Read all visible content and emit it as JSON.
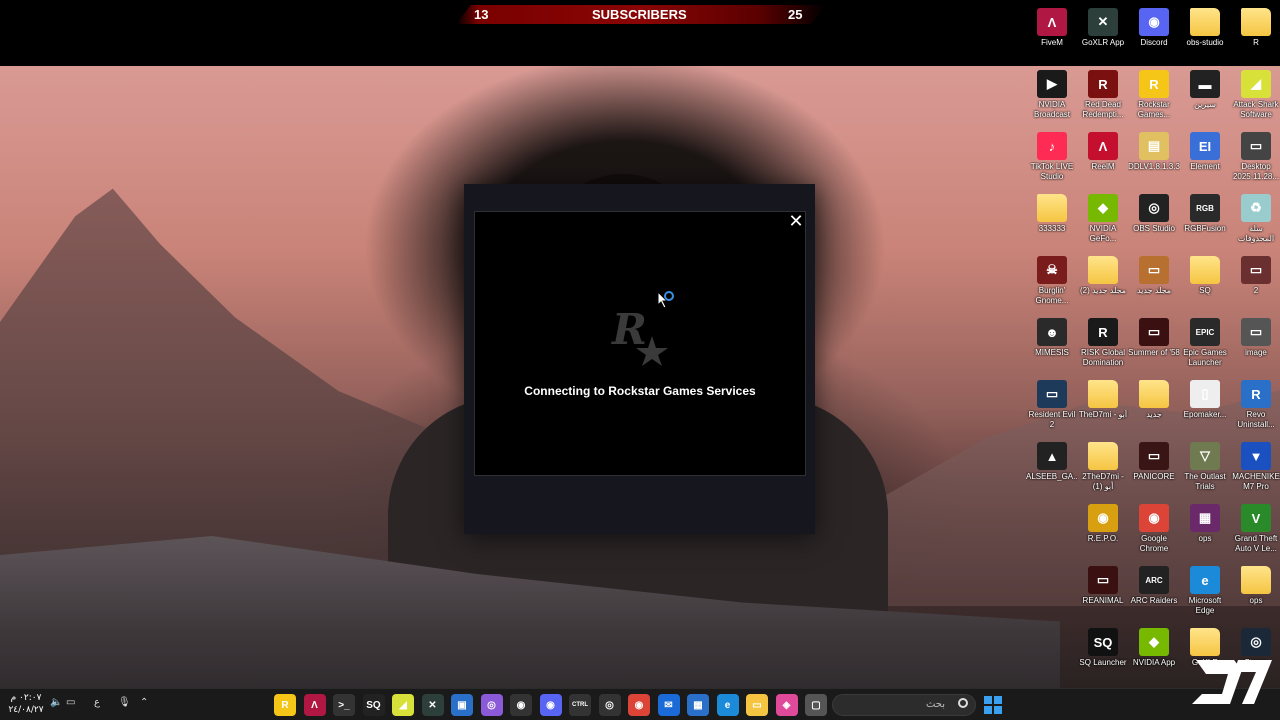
{
  "stream_bar": {
    "left_value": "13",
    "title": "SUBSCRIBERS",
    "right_value": "25"
  },
  "launcher": {
    "status_text": "Connecting to Rockstar Games Services",
    "close_label": "✕"
  },
  "desktop_icons": [
    {
      "label": "FiveM",
      "color": "#b01843",
      "glyph": "Λ"
    },
    {
      "label": "GoXLR App",
      "color": "#2c3f3a",
      "glyph": "✕"
    },
    {
      "label": "Discord",
      "color": "#5865f2",
      "glyph": "◉"
    },
    {
      "label": "obs-studio",
      "folder": true
    },
    {
      "label": "R",
      "folder": true
    },
    {
      "label": "NVIDIA Broadcast",
      "color": "#1a1a1a",
      "glyph": "▶"
    },
    {
      "label": "Red Dead Redempti...",
      "color": "#7a1010",
      "glyph": "R"
    },
    {
      "label": "Rockstar Games...",
      "color": "#f5c518",
      "glyph": "R"
    },
    {
      "label": "سيزين",
      "color": "#222",
      "glyph": "▬"
    },
    {
      "label": "Attack Shark Software",
      "color": "#d8e03a",
      "glyph": "◢"
    },
    {
      "label": "TikTok LIVE Studio",
      "color": "#fe2c55",
      "glyph": "♪"
    },
    {
      "label": "ReelM",
      "color": "#c4102e",
      "glyph": "Λ"
    },
    {
      "label": "DDLV1.8.1.3.3",
      "color": "#e0c060",
      "glyph": "▤"
    },
    {
      "label": "Element",
      "color": "#3a6fd8",
      "glyph": "EI"
    },
    {
      "label": "Desktop 2025.11.28...",
      "color": "#444",
      "glyph": "▭"
    },
    {
      "label": "333333",
      "folder": true
    },
    {
      "label": "NVIDIA GeFo...",
      "color": "#76b900",
      "glyph": "◆"
    },
    {
      "label": "OBS Studio",
      "color": "#222",
      "glyph": "◎"
    },
    {
      "label": "RGBFusion",
      "color": "#2a2a2a",
      "glyph": "RGB"
    },
    {
      "label": "سلة المحذوفات",
      "color": "#9cc",
      "glyph": "♻"
    },
    {
      "label": "Burglin' Gnome...",
      "color": "#7a1c1c",
      "glyph": "☠"
    },
    {
      "label": "مجلد جديد (2)",
      "folder": true
    },
    {
      "label": "مجلد جديد",
      "color": "#b87030",
      "glyph": "▭"
    },
    {
      "label": "SQ",
      "folder": true
    },
    {
      "label": "2",
      "color": "#6a3030",
      "glyph": "▭"
    },
    {
      "label": "MIMESIS",
      "color": "#2a2a2a",
      "glyph": "☻"
    },
    {
      "label": "RISK Global Domination",
      "color": "#1a1a1a",
      "glyph": "R"
    },
    {
      "label": "Summer of '58",
      "color": "#3a1010",
      "glyph": "▭"
    },
    {
      "label": "Epic Games Launcher",
      "color": "#2a2a2a",
      "glyph": "EPIC"
    },
    {
      "label": "image",
      "color": "#555",
      "glyph": "▭"
    },
    {
      "label": "Resident Evil 2",
      "color": "#1e3a5a",
      "glyph": "▭"
    },
    {
      "label": "TheD7mi - أبو",
      "folder": true
    },
    {
      "label": "جديد",
      "folder": true
    },
    {
      "label": "Epomaker...",
      "color": "#eeeeee",
      "glyph": "▯"
    },
    {
      "label": "Revo Uninstall...",
      "color": "#2a70c8",
      "glyph": "R"
    },
    {
      "label": "ALSEEB_GA...",
      "color": "#222",
      "glyph": "▲"
    },
    {
      "label": "2TheD7mi - أبو (1)",
      "folder": true
    },
    {
      "label": "PANICORE",
      "color": "#3a1515",
      "glyph": "▭"
    },
    {
      "label": "The Outlast Trials",
      "color": "#707a50",
      "glyph": "▽"
    },
    {
      "label": "MACHENIKE M7 Pro",
      "color": "#1a50c0",
      "glyph": "▼"
    },
    {
      "label": "R.E.P.O.",
      "color": "#d8a010",
      "glyph": "◉"
    },
    {
      "label": "Google Chrome",
      "color": "#db4437",
      "glyph": "◉"
    },
    {
      "label": "ops",
      "color": "#6a2a6a",
      "glyph": "▦"
    },
    {
      "label": "Grand Theft Auto V Le...",
      "color": "#2a8a2a",
      "glyph": "V"
    },
    {
      "label": "REANIMAL",
      "color": "#3a1010",
      "glyph": "▭"
    },
    {
      "label": "ARC Raiders",
      "color": "#222",
      "glyph": "ARC"
    },
    {
      "label": "Microsoft Edge",
      "color": "#1b8ad8",
      "glyph": "e"
    },
    {
      "label": "ops",
      "folder": true
    },
    {
      "label": "SQ Launcher",
      "color": "#111",
      "glyph": "SQ"
    },
    {
      "label": "NVIDIA App",
      "color": "#76b900",
      "glyph": "◆"
    },
    {
      "label": "GoXLR",
      "folder": true
    },
    {
      "label": "Steam",
      "color": "#1b2838",
      "glyph": "◎"
    }
  ],
  "taskbar": {
    "search_placeholder": "بحث",
    "clock_time": "٠٢:٠٧ م",
    "clock_date": "٢٤/٠٨/٢٧",
    "tray_lang": "ع",
    "apps": [
      {
        "name": "rockstar",
        "glyph": "R",
        "color": "#f5c518"
      },
      {
        "name": "fivem",
        "glyph": "Λ",
        "color": "#b01843"
      },
      {
        "name": "terminal",
        "glyph": ">_",
        "color": "#333"
      },
      {
        "name": "sq",
        "glyph": "SQ",
        "color": "#222"
      },
      {
        "name": "attack-shark",
        "glyph": "◢",
        "color": "#d8e03a"
      },
      {
        "name": "goxlr",
        "glyph": "✕",
        "color": "#2c3f3a"
      },
      {
        "name": "window-app",
        "glyph": "▣",
        "color": "#2a70c8"
      },
      {
        "name": "purple-app",
        "glyph": "◎",
        "color": "#8a5ad8"
      },
      {
        "name": "github",
        "glyph": "◉",
        "color": "#333"
      },
      {
        "name": "discord",
        "glyph": "◉",
        "color": "#5865f2"
      },
      {
        "name": "ctrl",
        "glyph": "CTRL",
        "color": "#333"
      },
      {
        "name": "obs",
        "glyph": "◎",
        "color": "#333"
      },
      {
        "name": "chrome",
        "glyph": "◉",
        "color": "#db4437"
      },
      {
        "name": "outlook",
        "glyph": "✉",
        "color": "#1a6ad8"
      },
      {
        "name": "store",
        "glyph": "▦",
        "color": "#2a70c8"
      },
      {
        "name": "edge",
        "glyph": "e",
        "color": "#1b8ad8"
      },
      {
        "name": "explorer",
        "glyph": "▭",
        "color": "#f5c542"
      },
      {
        "name": "copilot",
        "glyph": "◈",
        "color": "#e04a9a"
      },
      {
        "name": "task-view",
        "glyph": "▢",
        "color": "#555"
      }
    ]
  }
}
